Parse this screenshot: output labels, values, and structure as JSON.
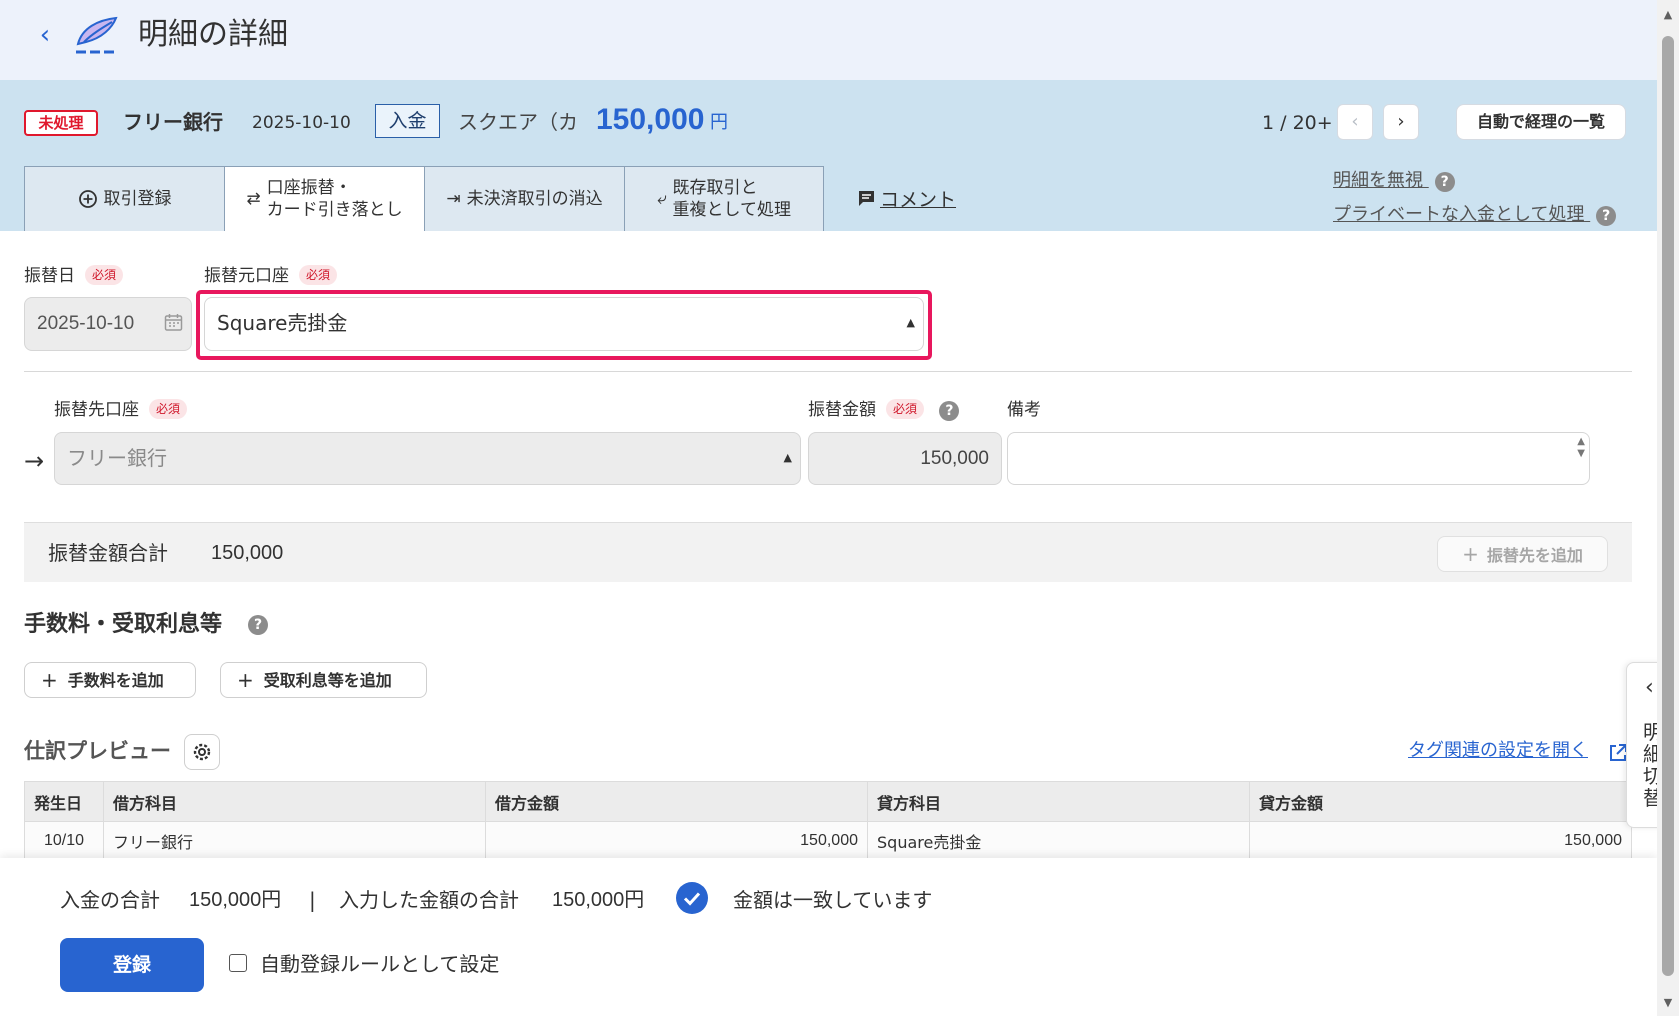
{
  "header": {
    "title": "明細の詳細"
  },
  "summary": {
    "status_badge": "未処理",
    "bank_name": "フリー銀行",
    "date": "2025-10-10",
    "type_tag": "入金",
    "partner": "スクエア（カ",
    "amount": "150,000",
    "currency": "円",
    "pager": "1 / 20+",
    "auto_list_button": "自動で経理の一覧"
  },
  "tabs": [
    {
      "label_line1": "取引登録",
      "label_line2": ""
    },
    {
      "label_line1": "口座振替・",
      "label_line2": "カード引き落とし"
    },
    {
      "label_line1": "未決済取引の消込",
      "label_line2": ""
    },
    {
      "label_line1": "既存取引と",
      "label_line2": "重複として処理"
    }
  ],
  "comment_link": "コメント",
  "side_links": {
    "ignore": "明細を無視",
    "private": "プライベートな入金として処理"
  },
  "form": {
    "required_badge": "必須",
    "transfer_date_label": "振替日",
    "transfer_date_value": "2025-10-10",
    "source_account_label": "振替元口座",
    "source_account_value": "Square売掛金",
    "dest_account_label": "振替先口座",
    "dest_account_value": "フリー銀行",
    "transfer_amount_label": "振替金額",
    "transfer_amount_value": "150,000",
    "memo_label": "備考"
  },
  "total": {
    "label": "振替金額合計",
    "value": "150,000",
    "add_dest_button": "振替先を追加"
  },
  "fees": {
    "title": "手数料・受取利息等",
    "add_fee_button": "手数料を追加",
    "add_interest_button": "受取利息等を追加"
  },
  "preview": {
    "title": "仕訳プレビュー",
    "tag_settings_link": "タグ関連の設定を開く",
    "columns": [
      "発生日",
      "借方科目",
      "借方金額",
      "貸方科目",
      "貸方金額"
    ],
    "rows": [
      [
        "10/10",
        "フリー銀行",
        "150,000",
        "Square売掛金",
        "150,000"
      ]
    ]
  },
  "footer": {
    "deposit_total_label": "入金の合計",
    "deposit_total_value": "150,000円",
    "separator": "|",
    "entered_total_label": "入力した金額の合計",
    "entered_total_value": "150,000円",
    "match_message": "金額は一致しています",
    "register_button": "登録",
    "auto_rule_label": "自動登録ルールとして設定"
  },
  "side_toggle": {
    "label": "明細切替"
  },
  "colors": {
    "accent": "#2864d0",
    "highlight": "#e8175d",
    "summary_bg": "#cce2f0",
    "badge_red": "#e0182d"
  }
}
